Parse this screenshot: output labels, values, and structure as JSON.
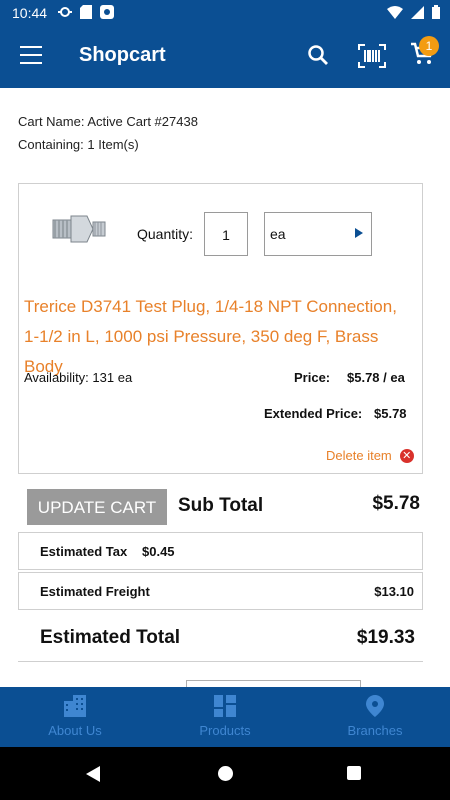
{
  "status": {
    "time": "10:44"
  },
  "appbar": {
    "title": "Shopcart",
    "cart_badge": "1"
  },
  "cart": {
    "name_label": "Cart Name:",
    "name": "Active Cart #27438",
    "containing_label": "Containing:",
    "containing": "1 Item(s)"
  },
  "item": {
    "quantity_label": "Quantity:",
    "quantity": "1",
    "unit": "ea",
    "product_name": "Trerice D3741 Test Plug, 1/4-18 NPT Connection, 1-1/2 in L, 1000 psi Pressure, 350 deg F, Brass Body",
    "availability_label": "Availability:",
    "availability": "131 ea",
    "price_label": "Price:",
    "price": "$5.78 / ea",
    "extended_label": "Extended Price:",
    "extended": "$5.78",
    "delete_label": "Delete item"
  },
  "summary": {
    "update_label": "UPDATE CART",
    "subtotal_label": "Sub Total",
    "subtotal": "$5.78",
    "tax_label": "Estimated Tax",
    "tax_inline": "$0.45",
    "freight_label": "Estimated Freight",
    "freight": "$13.10",
    "total_label": "Estimated Total",
    "total": "$19.33"
  },
  "bottomnav": {
    "items": [
      {
        "label": "About Us",
        "icon": "building-icon"
      },
      {
        "label": "Products",
        "icon": "grid-icon"
      },
      {
        "label": "Branches",
        "icon": "location-pin-icon"
      }
    ]
  },
  "colors": {
    "primary": "#0b4f93",
    "accent": "#e8812a",
    "badge": "#f39c12"
  }
}
